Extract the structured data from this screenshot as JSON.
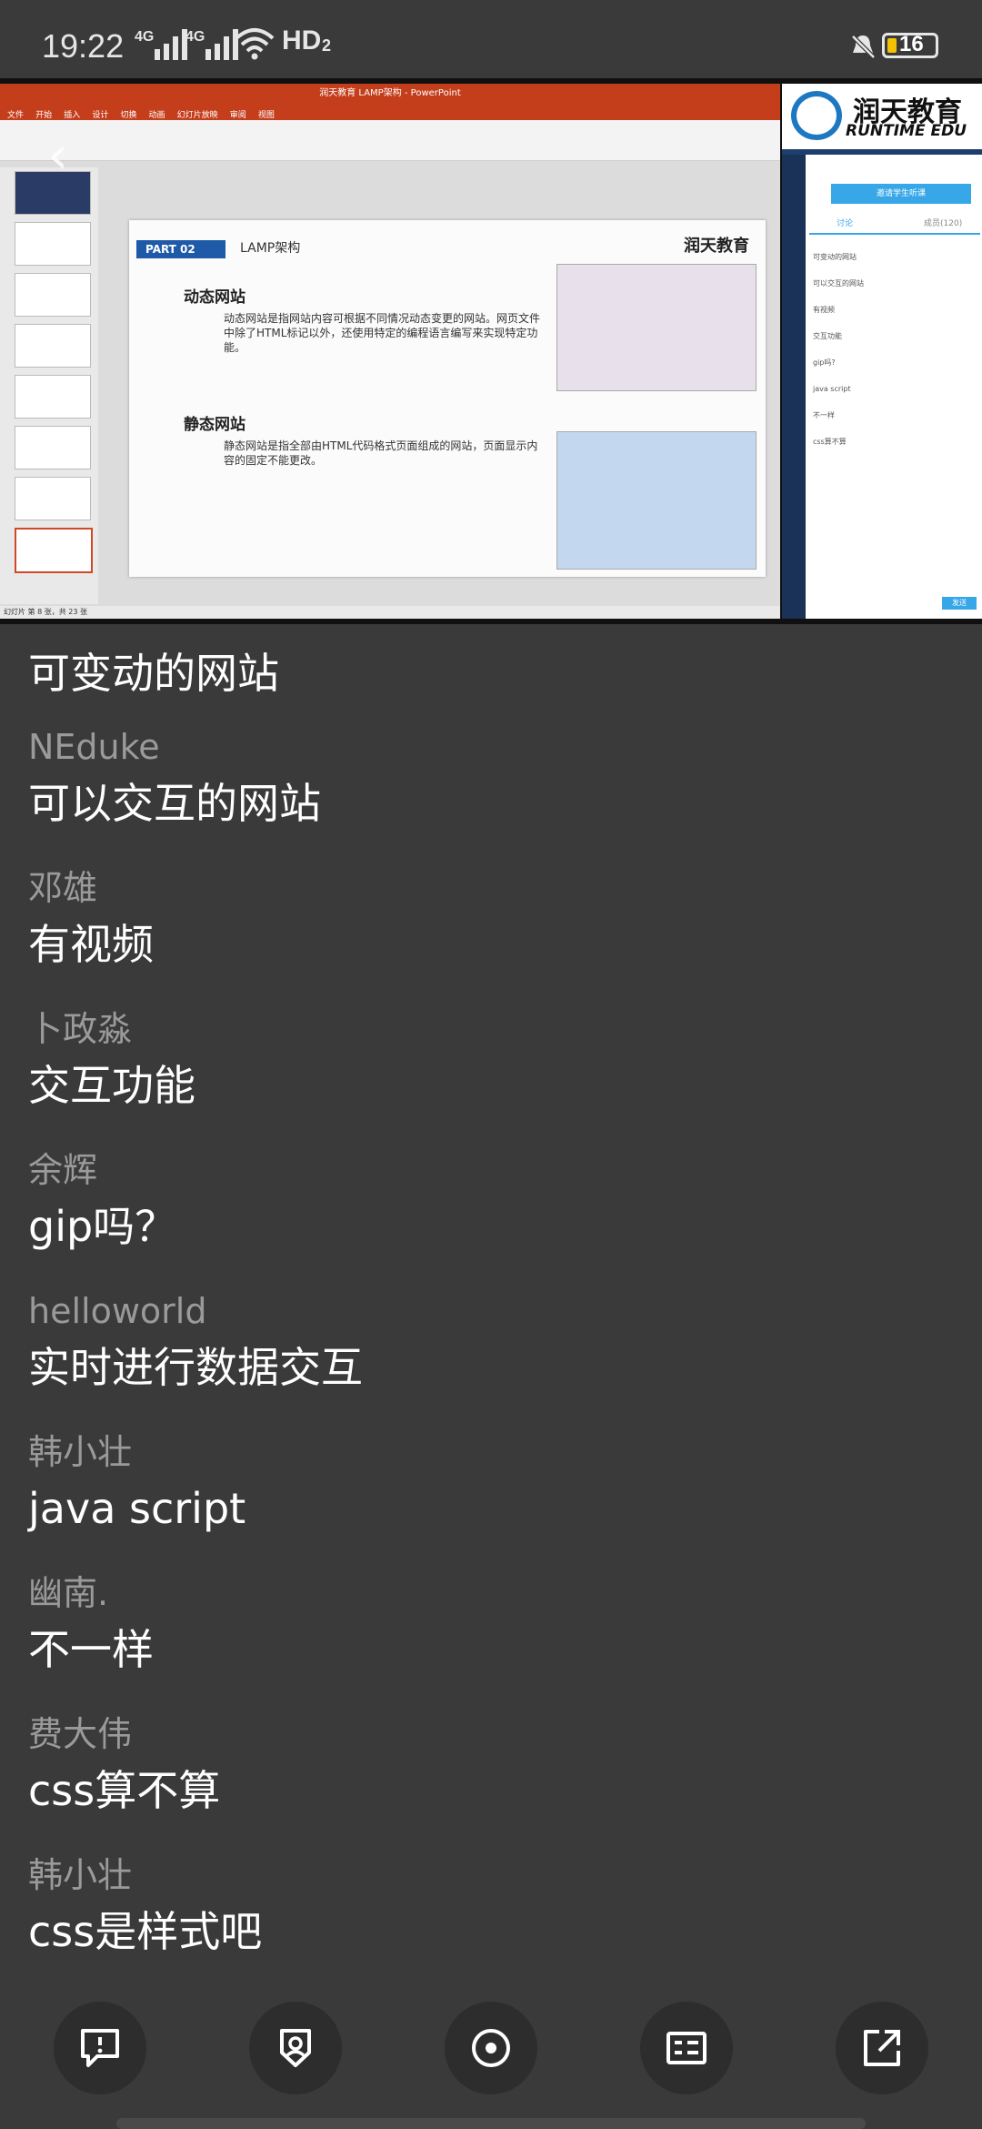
{
  "status_bar": {
    "time": "19:22",
    "signal_1": "4G",
    "signal_2": "4G",
    "network": "HD",
    "network_sub": "2",
    "battery": "16"
  },
  "video": {
    "ppt_title": "润天教育 LAMP架构 - PowerPoint",
    "ppt_tabs": [
      "文件",
      "开始",
      "插入",
      "设计",
      "切换",
      "动画",
      "幻灯片放映",
      "审阅",
      "视图"
    ],
    "slide": {
      "part_label": "PART 02",
      "section_title": "LAMP架构",
      "logo_text": "润天教育",
      "heading_dynamic": "动态网站",
      "text_dynamic": "动态网站是指网站内容可根据不同情况动态变更的网站。网页文件中除了HTML标记以外，还使用特定的编程语言编写来实现特定功能。",
      "heading_static": "静态网站",
      "text_static": "静态网站是指全部由HTML代码格式页面组成的网站，页面显示内容的固定不能更改。"
    },
    "ppt_status": "幻灯片 第 8 张，共 23 张",
    "side_panel": {
      "brand_cn": "润天教育",
      "brand_en": "RUNTIME EDU",
      "invite_button": "邀请学生听课",
      "tab_chat": "讨论",
      "tab_members": "成员(120)",
      "chat_lines": [
        "可变动的网站",
        "可以交互的网站",
        "有视频",
        "交互功能",
        "gip吗?",
        "java script",
        "不一样",
        "css算不算"
      ],
      "send_button": "发送"
    }
  },
  "first_message": "可变动的网站",
  "messages": [
    {
      "name": "NEduke",
      "text": "可以交互的网站"
    },
    {
      "name": "邓雄",
      "text": "有视频"
    },
    {
      "name": "卜政淼",
      "text": "交互功能"
    },
    {
      "name": "余辉",
      "text": "gip吗？"
    },
    {
      "name": "helloworld",
      "text": "实时进行数据交互"
    },
    {
      "name": "韩小壮",
      "text": "java script"
    },
    {
      "name": "幽南.",
      "text": "不一样"
    },
    {
      "name": "费大伟",
      "text": "css算不算"
    },
    {
      "name": "韩小壮",
      "text": "css是样式吧"
    }
  ],
  "bottom_bar": {
    "buttons": [
      {
        "icon": "chat-bubble-icon"
      },
      {
        "icon": "badge-shield-icon"
      },
      {
        "icon": "target-icon"
      },
      {
        "icon": "id-card-icon"
      },
      {
        "icon": "share-external-icon"
      }
    ]
  }
}
